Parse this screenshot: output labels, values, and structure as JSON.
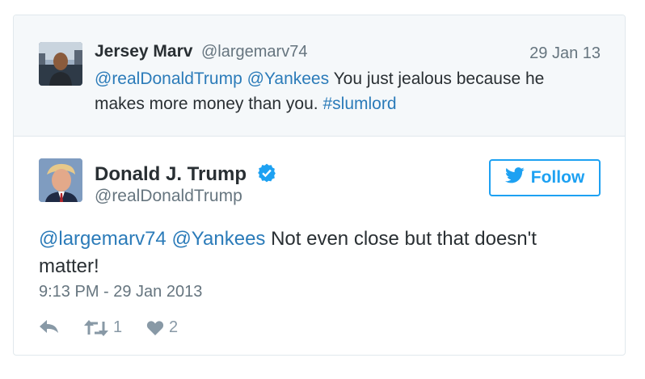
{
  "parent_tweet": {
    "name": "Jersey Marv",
    "handle": "@largemarv74",
    "date": "29 Jan 13",
    "mention1": "@realDonaldTrump",
    "mention2": "@Yankees",
    "text": "You just jealous because he makes more money than you.",
    "hashtag": "#slumlord"
  },
  "tweet": {
    "name": "Donald J. Trump",
    "handle": "@realDonaldTrump",
    "follow_label": "Follow",
    "mention1": "@largemarv74",
    "mention2": "@Yankees",
    "text": "Not even close but that doesn't matter!",
    "timestamp": "9:13 PM - 29 Jan 2013",
    "retweet_count": "1",
    "like_count": "2"
  },
  "colors": {
    "link": "#2b7bb9",
    "accent": "#1da1f2",
    "secondary_text": "#66757f",
    "icon_gray": "#8899a6"
  },
  "icons": {
    "reply": "reply-icon",
    "retweet": "retweet-icon",
    "like": "heart-icon",
    "verified": "verified-badge-icon",
    "bird": "twitter-bird-icon"
  }
}
